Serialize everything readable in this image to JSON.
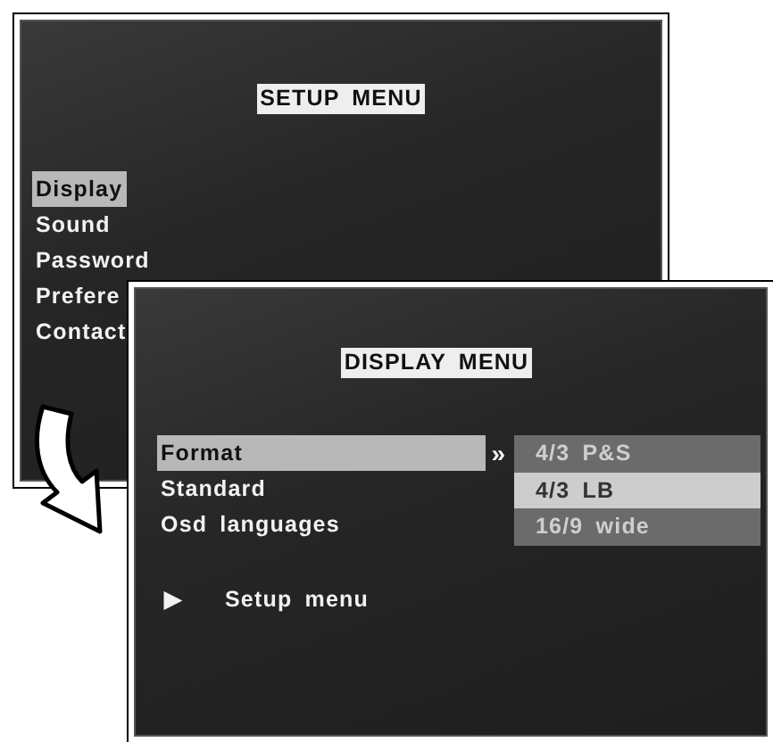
{
  "setup_screen": {
    "title": "SETUP MENU",
    "items": [
      {
        "label": "Display",
        "selected": true
      },
      {
        "label": "Sound",
        "selected": false
      },
      {
        "label": "Password",
        "selected": false
      },
      {
        "label": "Prefere",
        "selected": false
      },
      {
        "label": "Contact",
        "selected": false
      }
    ]
  },
  "display_screen": {
    "title": "DISPLAY MENU",
    "items": [
      {
        "label": "Format",
        "selected": true
      },
      {
        "label": "Standard",
        "selected": false
      },
      {
        "label": "Osd languages",
        "selected": false
      }
    ],
    "submenu_marker": "»",
    "options": [
      {
        "label": "4/3 P&S",
        "selected": false
      },
      {
        "label": "4/3 LB",
        "selected": true
      },
      {
        "label": "16/9 wide",
        "selected": false
      }
    ],
    "back": {
      "marker": "▶",
      "label": "Setup menu"
    }
  }
}
